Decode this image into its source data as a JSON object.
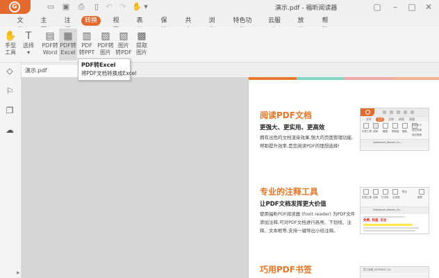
{
  "window": {
    "title": "演示.pdf - 福昕阅读器"
  },
  "menu": {
    "items": [
      "文件",
      "主页",
      "注释",
      "转换",
      "视图",
      "表单",
      "保护",
      "共享",
      "浏览",
      "特色功能",
      "云服务",
      "放映",
      "帮助"
    ],
    "active_index": 3
  },
  "ribbon": {
    "tools": [
      {
        "label": "手型\n工具",
        "icon": "hand-icon"
      },
      {
        "label": "选择\n▾",
        "icon": "text-cursor-icon"
      },
      {
        "label": "PDF转\nWord",
        "icon": "pdf-to-word-icon"
      },
      {
        "label": "PDF转\nExcel",
        "icon": "pdf-to-excel-icon"
      },
      {
        "label": "PDF\n转PPT",
        "icon": "pdf-to-ppt-icon"
      },
      {
        "label": "PDF转\n图片",
        "icon": "pdf-to-image-icon"
      },
      {
        "label": "图片\n转PDF",
        "icon": "image-to-pdf-icon"
      },
      {
        "label": "提取\n图片",
        "icon": "extract-image-icon"
      }
    ]
  },
  "tabs": {
    "document": "演示.pdf"
  },
  "tooltip": {
    "title": "PDF转Excel",
    "description": "将PDF文档转换成Excel"
  },
  "page": {
    "band_colors": [
      "#e87a2e",
      "#7fd6c8",
      "#f2a6a6",
      "#f3b38d"
    ],
    "sections": [
      {
        "heading": "阅读PDF文档",
        "subheading": "更强大、更实用、更高效",
        "body": "拥有出色的文档渲染效果,强大的页面管理功能,帮助提升效率,是您阅读PDF的理想选择!"
      },
      {
        "heading": "专业的注释工具",
        "subheading": "让PDF文档发挥更大价值",
        "body": "使用福昕PDF阅读器 (foxit reader) 为PDF文件添加注释,可对PDF文档进行高亮、下划线、注释、文本框等,支持一键导出小结注释。"
      },
      {
        "heading": "巧用PDF书签"
      }
    ],
    "mini_shots": [
      {
        "menu": [
          "文件",
          "主页",
          "注释",
          "转换",
          "视图"
        ],
        "tools": [
          "手型工具",
          "选择",
          "截图",
          "剪贴板",
          "缩放",
          "实际大小",
          "适合页面",
          "适合宽度"
        ],
        "tab": "Datasheet_Reader_Ch..."
      },
      {
        "menu": [
          "文件",
          "主页",
          "注释"
        ],
        "tools": [
          "手型工具",
          "选择",
          "打字机",
          "文本框",
          "附注",
          "图章"
        ],
        "tab": "Datasheet_Reader_Ch...",
        "highlight": "免费, 快速, 安全"
      },
      {
        "tab": "员工手册_20130917_01"
      }
    ]
  }
}
